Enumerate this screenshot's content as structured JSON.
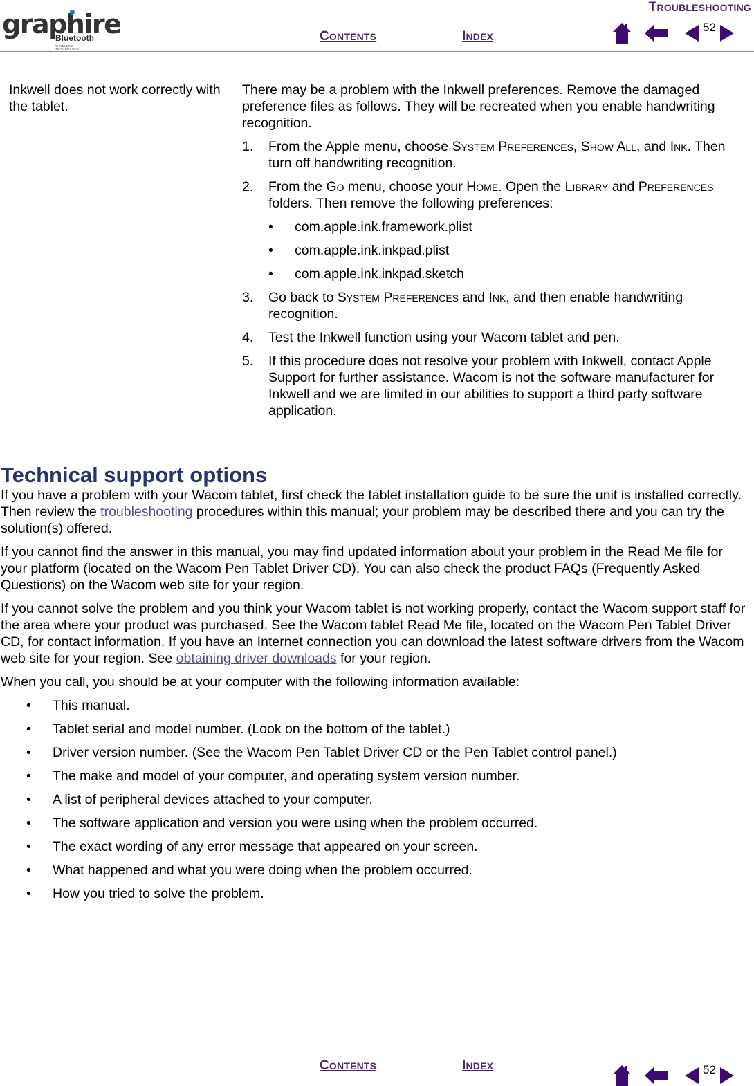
{
  "header": {
    "logo": {
      "word": "graphire",
      "sub": "Bluetooth",
      "tagline": "WIRELESS TECHNOLOGY"
    },
    "section_link": {
      "first": "T",
      "rest": "ROUBLESHOOTING"
    },
    "contents_link": {
      "first": "C",
      "rest": "ONTENTS"
    },
    "index_link": {
      "first": "I",
      "rest": "NDEX"
    },
    "page_number": "52",
    "nav_icons": [
      "home-icon",
      "back-arrow-icon",
      "previous-page-icon",
      "next-page-icon"
    ],
    "accent_color": "#3d0a6e"
  },
  "table": {
    "problem": "Inkwell does not work correctly with the tablet.",
    "solution_intro": "There may be a problem with the Inkwell preferences.  Remove the damaged preference files as follows.  They will be recreated when you enable handwriting recognition.",
    "steps": [
      {
        "num": "1.",
        "parts": [
          "From the Apple menu, choose ",
          "System Preferences",
          ", ",
          "Show All",
          ", and ",
          "Ink",
          ".  Then turn off handwriting recognition."
        ]
      },
      {
        "num": "2.",
        "parts": [
          "From the ",
          "Go",
          " menu, choose your ",
          "Home",
          ".  Open the ",
          "Library",
          " and ",
          "Preferences",
          " folders.  Then remove the following preferences:"
        ]
      },
      {
        "num": "3.",
        "parts": [
          "Go back to ",
          "System Preferences",
          " and ",
          "Ink",
          ", and then enable handwriting recognition."
        ]
      },
      {
        "num": "4.",
        "text": "Test the Inkwell function using your Wacom tablet and pen."
      },
      {
        "num": "5.",
        "text": "If this procedure does not resolve your problem with Inkwell, contact Apple Support for further assistance.  Wacom is not the software manufacturer for Inkwell and we are limited in our abilities to support a third party software application."
      }
    ],
    "pref_files": [
      "com.apple.ink.framework.plist",
      "com.apple.ink.inkpad.plist",
      "com.apple.ink.inkpad.sketch"
    ],
    "bullet": "•"
  },
  "section": {
    "title": "Technical support options",
    "p1_before": "If you have a problem with your Wacom tablet, first check the tablet installation guide to be sure the unit is installed correctly.  Then review the ",
    "p1_link": "troubleshooting",
    "p1_after": " procedures within this manual; your problem may be described there and you can try the solution(s) offered.",
    "p2": "If you cannot find the answer in this manual, you may find updated information about your problem in the Read Me file for your platform (located on the Wacom Pen Tablet Driver CD).  You can also check the product FAQs (Frequently Asked Questions) on the Wacom web site for your region.",
    "p3_before": "If you cannot solve the problem and you think your Wacom tablet is not working properly, contact the Wacom support staff for the area where your product was purchased.  See the Wacom tablet Read Me file, located on the Wacom Pen Tablet Driver CD, for contact information.  If you have an Internet connection you can download the latest software drivers from the Wacom web site for your region.  See ",
    "p3_link": "obtaining driver downloads",
    "p3_after": " for your region.",
    "p4": "When you call, you should be at your computer with the following information available:",
    "bullets": [
      "This manual.",
      "Tablet serial and model number.  (Look on the bottom of the tablet.)",
      "Driver version number.  (See the Wacom Pen Tablet Driver CD or the Pen Tablet control panel.)",
      "The make and model of your computer, and operating system version number.",
      "A list of peripheral devices attached to your computer.",
      "The software application and version you were using when the problem occurred.",
      "The exact wording of any error message that appeared on your screen.",
      "What happened and what you were doing when the problem occurred.",
      "How you tried to solve the problem."
    ]
  },
  "footer": {
    "contents_link": {
      "first": "C",
      "rest": "ONTENTS"
    },
    "index_link": {
      "first": "I",
      "rest": "NDEX"
    },
    "page_number": "52"
  }
}
